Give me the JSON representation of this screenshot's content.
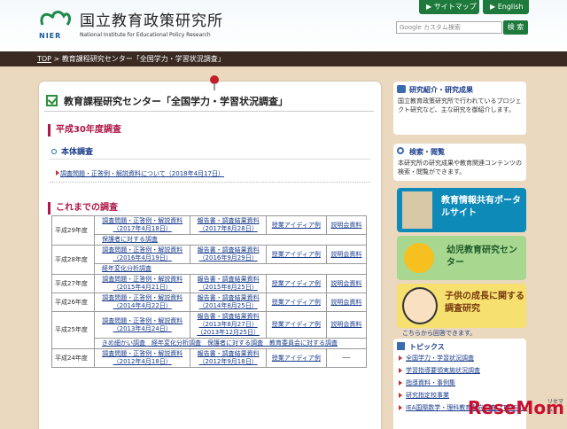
{
  "header": {
    "logo_text": "NIER",
    "org_name_jp": "国立教育政策研究所",
    "org_name_en": "National Institute for Educational Policy Research",
    "sitemap_label": "▶ サイトマップ",
    "english_label": "▶ English",
    "search_placeholder": "Google カスタム検索",
    "search_button": "検 索"
  },
  "breadcrumb": {
    "top": "TOP",
    "sep": " > ",
    "current": "教育課程研究センター「全国学力・学習状況調査」"
  },
  "page": {
    "title": "教育課程研究センター「全国学力・学習状況調査」",
    "section1": "平成30年度調査",
    "subsection1": "本体調査",
    "link1": "調査問題・正答例・解説資料について（2018年4月17日）",
    "section2": "これまでの調査"
  },
  "table": {
    "rows": [
      {
        "year": "平成29年度",
        "c1a": "調査問題・正答例・解説資料",
        "c1b": "（2017年4月18日）",
        "c2a": "報告書・調査結果資料",
        "c2b": "（2017年8月28日）",
        "c3": "授業アイディア例",
        "c4": "説明会資料",
        "extra": "保護者に対する調査"
      },
      {
        "year": "平成28年度",
        "c1a": "調査問題・正答例・解説資料",
        "c1b": "（2016年4月19日）",
        "c2a": "報告書・調査結果資料",
        "c2b": "（2016年9月29日）",
        "c3": "授業アイディア例",
        "c4": "説明会資料",
        "extra": "経年変化分析調査"
      },
      {
        "year": "平成27年度",
        "c1a": "調査問題・正答例・解説資料",
        "c1b": "（2015年4月21日）",
        "c2a": "報告書・調査結果資料",
        "c2b": "（2015年8月25日）",
        "c3": "授業アイディア例",
        "c4": "説明会資料",
        "extra": ""
      },
      {
        "year": "平成26年度",
        "c1a": "調査問題・正答例・解説資料",
        "c1b": "（2014年4月22日）",
        "c2a": "報告書・調査結果資料",
        "c2b": "（2014年8月25日）",
        "c3": "授業アイディア例",
        "c4": "説明会資料",
        "extra": ""
      },
      {
        "year": "平成25年度",
        "c1a": "調査問題・正答例・解説資料",
        "c1b": "（2013年4月24日）",
        "c2a": "報告書・調査結果資料",
        "c2b": "（2013年8月27日）",
        "c2c": "（2013年12月25日）",
        "c3": "授業アイディア例",
        "c4": "説明会資料",
        "extra": "きめ細かい調査　経年変化分析調査　保護者に対する調査　教育委員会に対する調査"
      },
      {
        "year": "平成24年度",
        "c1a": "調査問題・正答例・解説資料",
        "c1b": "（2012年4月18日）",
        "c2a": "報告書・調査結果資料",
        "c2b": "（2012年9月18日）",
        "c3": "授業アイディア例",
        "c4": "──",
        "extra": ""
      }
    ]
  },
  "sidebar": {
    "box1_title": "研究紹介・研究成果",
    "box1_text": "国立教育政策研究所で行われているプロジェクト研究など、主な研究を御紹介します。",
    "box2_title": "検索・閲覧",
    "box2_text": "本研究所の研究成果や教育関連コンテンツの検索・閲覧ができます。",
    "banner1": "教育情報共有ポータルサイト",
    "banner2": "幼児教育研究センター",
    "banner3": "子供の成長に関する調査研究",
    "banner3_note": "こちらから回答できます。",
    "topics_title": "トピックス",
    "topics": [
      "全国学力・学習状況調査",
      "学習指導要領実施状況調査",
      "指導資料・事例集",
      "研究指定校事業",
      "IEA国際数学・理科教育動向調査（TIMSS）"
    ]
  },
  "watermark": {
    "text": "ReseMom",
    "sub": "リセマム"
  },
  "colors": {
    "accent": "#1e7a3c",
    "section": "#b01848",
    "crumb_bg": "#3a2a22",
    "bg": "#ead8bf"
  }
}
